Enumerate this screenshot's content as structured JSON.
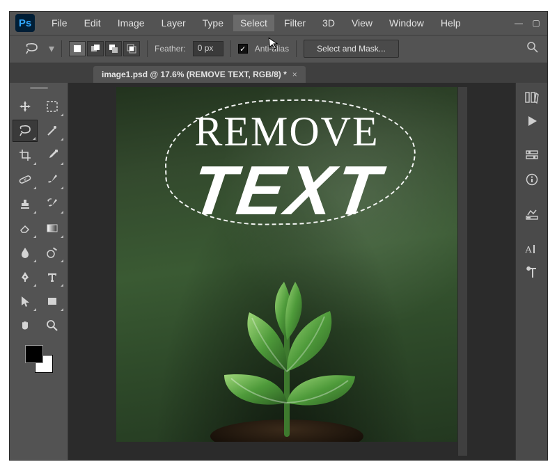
{
  "menubar": {
    "items": [
      "File",
      "Edit",
      "Image",
      "Layer",
      "Type",
      "Select",
      "Filter",
      "3D",
      "View",
      "Window",
      "Help"
    ],
    "active_index": 5
  },
  "window_controls": {
    "minimize": "—",
    "maximize": "▢",
    "close": "✕"
  },
  "options_bar": {
    "feather_label": "Feather:",
    "feather_value": "0 px",
    "anti_alias_label": "Anti-alias",
    "anti_alias_checked": true,
    "select_and_mask": "Select and Mask..."
  },
  "document": {
    "tab_title": "image1.psd @ 17.6% (REMOVE TEXT, RGB/8) *"
  },
  "canvas_text": {
    "line1": "REMOVE",
    "line2": "TEXT"
  },
  "tools": {
    "left": [
      "move-tool",
      "marquee-tool",
      "lasso-tool",
      "magic-wand-tool",
      "crop-tool",
      "eyedropper-tool",
      "healing-brush-tool",
      "brush-tool",
      "clone-stamp-tool",
      "history-brush-tool",
      "eraser-tool",
      "gradient-tool",
      "blur-tool",
      "dodge-tool",
      "pen-tool",
      "type-tool",
      "path-select-tool",
      "rectangle-tool",
      "hand-tool",
      "zoom-tool"
    ],
    "left_icons": [
      "move",
      "marquee",
      "lasso",
      "wand",
      "crop",
      "eyedrop",
      "bandaid",
      "brush",
      "stamp",
      "historybrush",
      "eraser",
      "gradient",
      "blur",
      "dodge",
      "pen",
      "type",
      "arrow",
      "rect",
      "hand",
      "zoom"
    ],
    "active_tool": "lasso-tool"
  },
  "right_panels": [
    "history-panel",
    "actions-panel",
    "properties-panel",
    "info-panel",
    "adjustments-panel",
    "character-panel",
    "paragraph-panel"
  ],
  "colors": {
    "foreground": "#000000",
    "background": "#ffffff"
  }
}
